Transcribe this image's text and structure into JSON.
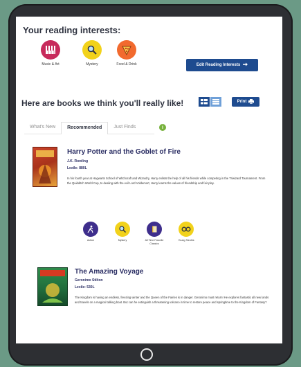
{
  "interests": {
    "heading": "Your reading interests:",
    "items": [
      {
        "label": "Music & Art",
        "icon": "piano-icon",
        "color": "#c72a5b"
      },
      {
        "label": "Mystery",
        "icon": "magnifier-icon",
        "color": "#f2d21b"
      },
      {
        "label": "Food & Drink",
        "icon": "pizza-icon",
        "color": "#f26a2e"
      }
    ],
    "edit_button": "Edit Reading Interests"
  },
  "recommendations": {
    "heading": "Here are books we think you'll really like!",
    "print_label": "Print",
    "tabs": [
      {
        "label": "What's New",
        "active": false
      },
      {
        "label": "Recommended",
        "active": true
      },
      {
        "label": "Just Finds",
        "active": false
      }
    ],
    "info_glyph": "i"
  },
  "books": [
    {
      "title": "Harry Potter and the Goblet of Fire",
      "author": "J.K. Rowling",
      "lexile": "Lexile: 880L",
      "description": "In his fourth year at Hogwarts School of Witchcraft and Wizardry, Harry enlists the help of all his friends while competing in the Triwizard Tournament. From the Quidditch World Cup, to dealing with the evil Lord Voldemort, Harry learns the values of friendship and fair play.",
      "cover_colors": [
        "#a9331b",
        "#e8a43a"
      ],
      "genres": [
        {
          "label": "Action",
          "icon": "runner-icon",
          "color": "#3e2e8c"
        },
        {
          "label": "Mystery",
          "icon": "magnifier-icon",
          "color": "#f2d21b"
        },
        {
          "label": "All Time Favorite Classics",
          "icon": "book-icon",
          "color": "#3e2e8c"
        },
        {
          "label": "Young Sleuths",
          "icon": "glasses-icon",
          "color": "#f2d21b"
        }
      ]
    },
    {
      "title": "The Amazing Voyage",
      "author": "Geronimo Stilton",
      "lexile": "Lexile: 530L",
      "description": "The Kingdom is having an endless, freezing winter and the Queen of the Fairies is in danger. Geronimo must return! He explores fantastic all new lands and travels on a magical talking boat. But can he extinguish a threatening volcano in time to restore peace and springtime to the Kingdom of Fantasy?",
      "cover_colors": [
        "#1f6a3b",
        "#d63a22"
      ]
    }
  ]
}
